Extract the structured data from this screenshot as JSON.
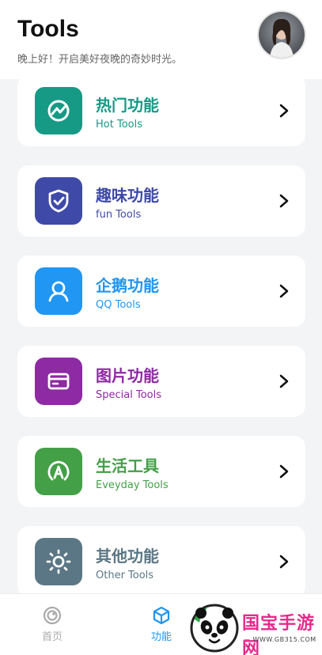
{
  "header": {
    "title": "Tools",
    "subtitle": "晚上好！开启美好夜晚的奇妙时光。"
  },
  "cards": [
    {
      "name": "热门功能",
      "sub": "Hot Tools",
      "color": "#169a86",
      "icon": "chart-circle-icon"
    },
    {
      "name": "趣味功能",
      "sub": "fun Tools",
      "color": "#3f4aa8",
      "icon": "shield-check-icon"
    },
    {
      "name": "企鹅功能",
      "sub": "QQ Tools",
      "color": "#2196f3",
      "icon": "person-icon"
    },
    {
      "name": "图片功能",
      "sub": "Special Tools",
      "color": "#8e2aa3",
      "icon": "card-icon"
    },
    {
      "name": "生活工具",
      "sub": "Eveyday Tools",
      "color": "#43a047",
      "icon": "a-letter-icon"
    },
    {
      "name": "其他功能",
      "sub": "Other Tools",
      "color": "#5b7785",
      "icon": "sun-icon"
    }
  ],
  "tabbar": {
    "home_label": "首页",
    "tools_label": "功能",
    "active_color": "#2196f3",
    "inactive_color": "#aaaaaa"
  },
  "watermark": {
    "brand": "国宝手游网",
    "url": "— WWW.GB315.COM —"
  }
}
